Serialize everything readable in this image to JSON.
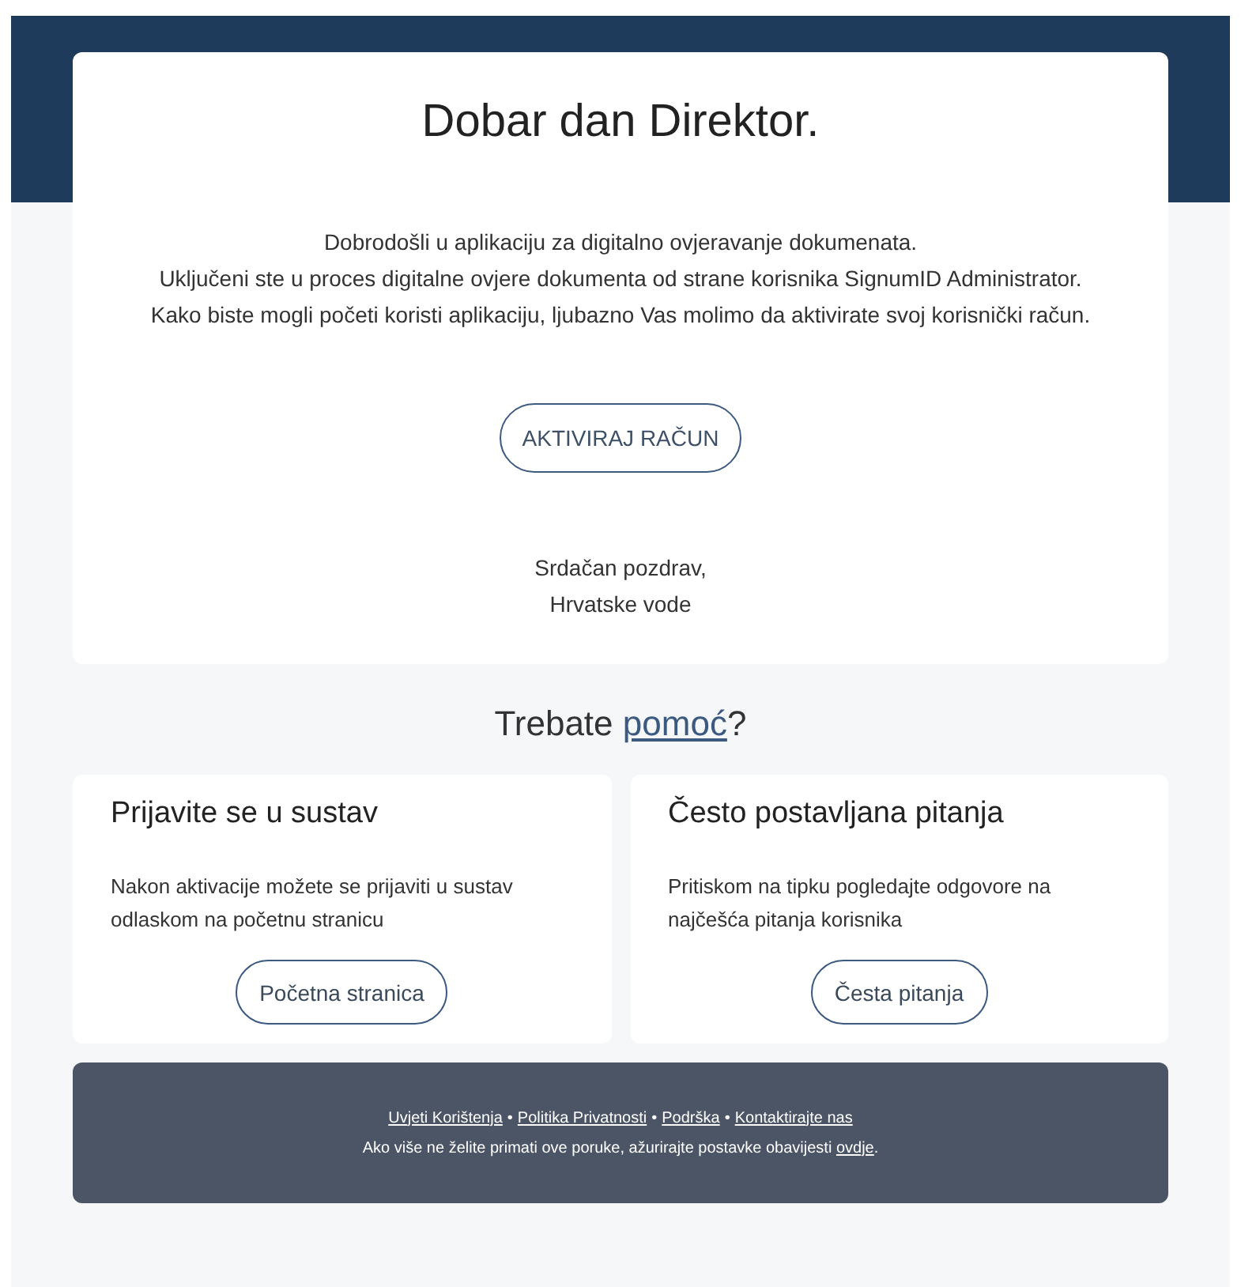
{
  "greeting": "Dobar dan Direktor.",
  "intro_lines": [
    "Dobrodošli u aplikaciju za digitalno ovjeravanje dokumenata.",
    "Uključeni ste u proces digitalne ovjere dokumenta od strane korisnika SignumID Administrator.",
    "Kako biste mogli početi koristi aplikaciju, ljubazno Vas molimo da aktivirate svoj korisnički račun."
  ],
  "activate_button": "AKTIVIRAJ RAČUN",
  "signature_lines": [
    "Srdačan pozdrav,",
    "Hrvatske vode"
  ],
  "help_heading": {
    "prefix": "Trebate ",
    "link": "pomoć",
    "suffix": "?"
  },
  "cards": [
    {
      "title": "Prijavite se u sustav",
      "text": "Nakon aktivacije možete se prijaviti u sustav odlaskom na početnu stranicu",
      "button": "Početna stranica"
    },
    {
      "title": "Često postavljana pitanja",
      "text": "Pritiskom na tipku pogledajte odgovore na najčešća pitanja korisnika",
      "button": "Česta pitanja"
    }
  ],
  "footer": {
    "links": [
      "Uvjeti Korištenja",
      "Politika Privatnosti",
      "Podrška",
      "Kontaktirajte nas"
    ],
    "separator": "•",
    "unsubscribe": {
      "prefix": "Ako više ne želite primati ove poruke, ažurirajte postavke obavijesti ",
      "link": "ovdje",
      "suffix": "."
    }
  }
}
